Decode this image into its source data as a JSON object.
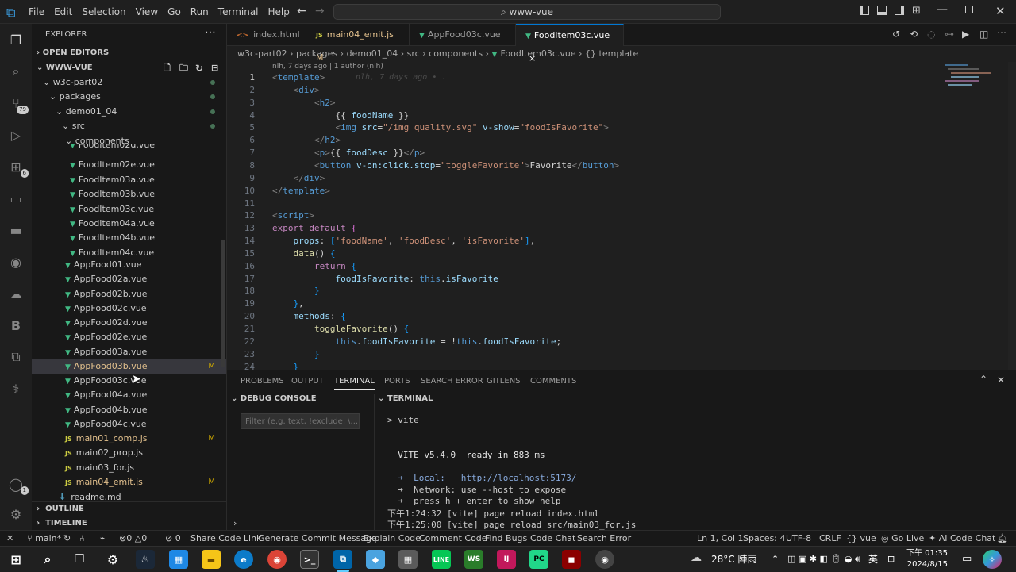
{
  "menu": [
    "File",
    "Edit",
    "Selection",
    "View",
    "Go",
    "Run",
    "Terminal",
    "Help"
  ],
  "search": {
    "label": "www-vue"
  },
  "explorer": {
    "title": "EXPLORER",
    "open_editors": "OPEN EDITORS",
    "workspace": "WWW-VUE",
    "folders": [
      "w3c-part02",
      "packages",
      "demo01_04",
      "src",
      "components"
    ],
    "component_files": [
      "FoodItem02d.vue",
      "FoodItem02e.vue",
      "FoodItem03a.vue",
      "FoodItem03b.vue",
      "FoodItem03c.vue",
      "FoodItem04a.vue",
      "FoodItem04b.vue",
      "FoodItem04c.vue"
    ],
    "src_files": [
      {
        "name": "AppFood01.vue",
        "type": "vue",
        "mark": ""
      },
      {
        "name": "AppFood02a.vue",
        "type": "vue",
        "mark": ""
      },
      {
        "name": "AppFood02b.vue",
        "type": "vue",
        "mark": ""
      },
      {
        "name": "AppFood02c.vue",
        "type": "vue",
        "mark": ""
      },
      {
        "name": "AppFood02d.vue",
        "type": "vue",
        "mark": ""
      },
      {
        "name": "AppFood02e.vue",
        "type": "vue",
        "mark": ""
      },
      {
        "name": "AppFood03a.vue",
        "type": "vue",
        "mark": ""
      },
      {
        "name": "AppFood03b.vue",
        "type": "vue",
        "mark": "M"
      },
      {
        "name": "AppFood03c.vue",
        "type": "vue",
        "mark": ""
      },
      {
        "name": "AppFood04a.vue",
        "type": "vue",
        "mark": ""
      },
      {
        "name": "AppFood04b.vue",
        "type": "vue",
        "mark": ""
      },
      {
        "name": "AppFood04c.vue",
        "type": "vue",
        "mark": ""
      },
      {
        "name": "main01_comp.js",
        "type": "js",
        "mark": "M"
      },
      {
        "name": "main02_prop.js",
        "type": "js",
        "mark": ""
      },
      {
        "name": "main03_for.js",
        "type": "js",
        "mark": ""
      },
      {
        "name": "main04_emit.js",
        "type": "js",
        "mark": "M"
      }
    ],
    "readme": "readme.md",
    "outline": "OUTLINE",
    "timeline": "TIMELINE"
  },
  "activity_badges": {
    "scm": "79",
    "extensions": "6",
    "accounts": "1"
  },
  "tabs": [
    {
      "label": "index.html",
      "icon": "<>",
      "mark": ""
    },
    {
      "label": "main04_emit.js",
      "icon": "JS",
      "mark": "M"
    },
    {
      "label": "AppFood03c.vue",
      "icon": "V",
      "mark": ""
    },
    {
      "label": "FoodItem03c.vue",
      "icon": "V",
      "mark": "×"
    }
  ],
  "breadcrumb": [
    "w3c-part02",
    "packages",
    "demo01_04",
    "src",
    "components",
    "FoodItem03c.vue",
    "{} template"
  ],
  "blame": "nlh, 7 days ago | 1 author (nlh)",
  "inline_blame": "nlh, 7 days ago • .",
  "code_lines": [
    [
      [
        "tg",
        "<"
      ],
      [
        "tn",
        "template"
      ],
      [
        "tg",
        ">"
      ]
    ],
    [
      [
        "pl",
        "    "
      ],
      [
        "tg",
        "<"
      ],
      [
        "tn",
        "div"
      ],
      [
        "tg",
        ">"
      ]
    ],
    [
      [
        "pl",
        "        "
      ],
      [
        "tg",
        "<"
      ],
      [
        "tn",
        "h2"
      ],
      [
        "tg",
        ">"
      ]
    ],
    [
      [
        "pl",
        "            "
      ],
      [
        "pl",
        "{{ "
      ],
      [
        "at",
        "foodName"
      ],
      [
        "pl",
        " }}"
      ]
    ],
    [
      [
        "pl",
        "            "
      ],
      [
        "tg",
        "<"
      ],
      [
        "tn",
        "img"
      ],
      [
        "pl",
        " "
      ],
      [
        "at",
        "src"
      ],
      [
        "pl",
        "="
      ],
      [
        "st",
        "\"/img_quality.svg\""
      ],
      [
        "pl",
        " "
      ],
      [
        "at",
        "v-show"
      ],
      [
        "pl",
        "="
      ],
      [
        "st",
        "\"foodIsFavorite\""
      ],
      [
        "tg",
        ">"
      ]
    ],
    [
      [
        "pl",
        "        "
      ],
      [
        "tg",
        "</"
      ],
      [
        "tn",
        "h2"
      ],
      [
        "tg",
        ">"
      ]
    ],
    [
      [
        "pl",
        "        "
      ],
      [
        "tg",
        "<"
      ],
      [
        "tn",
        "p"
      ],
      [
        "tg",
        ">"
      ],
      [
        "pl",
        "{{ "
      ],
      [
        "at",
        "foodDesc"
      ],
      [
        "pl",
        " }}"
      ],
      [
        "tg",
        "</"
      ],
      [
        "tn",
        "p"
      ],
      [
        "tg",
        ">"
      ]
    ],
    [
      [
        "pl",
        "        "
      ],
      [
        "tg",
        "<"
      ],
      [
        "tn",
        "button"
      ],
      [
        "pl",
        " "
      ],
      [
        "at",
        "v-on:click.stop"
      ],
      [
        "pl",
        "="
      ],
      [
        "st",
        "\"toggleFavorite\""
      ],
      [
        "tg",
        ">"
      ],
      [
        "pl",
        "Favorite"
      ],
      [
        "tg",
        "</"
      ],
      [
        "tn",
        "button"
      ],
      [
        "tg",
        ">"
      ]
    ],
    [
      [
        "pl",
        "    "
      ],
      [
        "tg",
        "</"
      ],
      [
        "tn",
        "div"
      ],
      [
        "tg",
        ">"
      ]
    ],
    [
      [
        "tg",
        "</"
      ],
      [
        "tn",
        "template"
      ],
      [
        "tg",
        ">"
      ]
    ],
    [
      [
        "pl",
        ""
      ]
    ],
    [
      [
        "tg",
        "<"
      ],
      [
        "tn",
        "script"
      ],
      [
        "tg",
        ">"
      ]
    ],
    [
      [
        "kw",
        "export default"
      ],
      [
        "pl",
        " "
      ],
      [
        "br",
        "{"
      ]
    ],
    [
      [
        "pl",
        "    "
      ],
      [
        "at",
        "props"
      ],
      [
        "pl",
        ": "
      ],
      [
        "br2",
        "["
      ],
      [
        "st",
        "'foodName'"
      ],
      [
        "pl",
        ", "
      ],
      [
        "st",
        "'foodDesc'"
      ],
      [
        "pl",
        ", "
      ],
      [
        "st",
        "'isFavorite'"
      ],
      [
        "br2",
        "]"
      ],
      [
        "pl",
        ","
      ]
    ],
    [
      [
        "pl",
        "    "
      ],
      [
        "fn",
        "data"
      ],
      [
        "pl",
        "() "
      ],
      [
        "br2",
        "{"
      ]
    ],
    [
      [
        "pl",
        "        "
      ],
      [
        "kw",
        "return"
      ],
      [
        "pl",
        " "
      ],
      [
        "br2",
        "{"
      ]
    ],
    [
      [
        "pl",
        "            "
      ],
      [
        "at",
        "foodIsFavorite"
      ],
      [
        "pl",
        ": "
      ],
      [
        "tn",
        "this"
      ],
      [
        "pl",
        "."
      ],
      [
        "at",
        "isFavorite"
      ]
    ],
    [
      [
        "pl",
        "        "
      ],
      [
        "br2",
        "}"
      ]
    ],
    [
      [
        "pl",
        "    "
      ],
      [
        "br2",
        "}"
      ],
      [
        "pl",
        ","
      ]
    ],
    [
      [
        "pl",
        "    "
      ],
      [
        "at",
        "methods"
      ],
      [
        "pl",
        ": "
      ],
      [
        "br2",
        "{"
      ]
    ],
    [
      [
        "pl",
        "        "
      ],
      [
        "fn",
        "toggleFavorite"
      ],
      [
        "pl",
        "() "
      ],
      [
        "br2",
        "{"
      ]
    ],
    [
      [
        "pl",
        "            "
      ],
      [
        "tn",
        "this"
      ],
      [
        "pl",
        "."
      ],
      [
        "at",
        "foodIsFavorite"
      ],
      [
        "pl",
        " = !"
      ],
      [
        "tn",
        "this"
      ],
      [
        "pl",
        "."
      ],
      [
        "at",
        "foodIsFavorite"
      ],
      [
        "pl",
        ";"
      ]
    ],
    [
      [
        "pl",
        "        "
      ],
      [
        "br2",
        "}"
      ]
    ],
    [
      [
        "pl",
        "    "
      ],
      [
        "br2",
        "}"
      ]
    ]
  ],
  "panel_tabs": [
    "PROBLEMS",
    "OUTPUT",
    "TERMINAL",
    "PORTS",
    "SEARCH ERROR",
    "GITLENS",
    "COMMENTS"
  ],
  "debug": {
    "title": "DEBUG CONSOLE",
    "filter_placeholder": "Filter (e.g. text, !exclude, \\..."
  },
  "terminal": {
    "title": "TERMINAL",
    "lines": [
      "> vite",
      "",
      "",
      "  VITE v5.4.0  ready in 883 ms",
      "",
      "  ➜  Local:   http://localhost:5173/",
      "  ➜  Network: use --host to expose",
      "  ➜  press h + enter to show help",
      "下午1:24:32 [vite] page reload index.html",
      "下午1:25:00 [vite] page reload src/main03_for.js"
    ]
  },
  "status": {
    "branch": "main*",
    "errors": "0",
    "warnings": "0",
    "ports": "0",
    "items_left": [
      "Share Code Link",
      "Generate Commit Message",
      "Explain Code",
      "Comment Code",
      "Find Bugs",
      "Code Chat",
      "Search Error"
    ],
    "position": "Ln 1, Col 1",
    "spaces": "Spaces: 4",
    "encoding": "UTF-8",
    "eol": "CRLF",
    "language": "vue",
    "golive": "Go Live",
    "aichat": "AI Code Chat"
  },
  "taskbar": {
    "weather": "28°C  陣雨",
    "ime": "英",
    "time": "下午 01:35",
    "date": "2024/8/15"
  },
  "colors": {
    "accent": "#0078d4",
    "vue_green": "#41b883",
    "modified": "#cca700"
  }
}
